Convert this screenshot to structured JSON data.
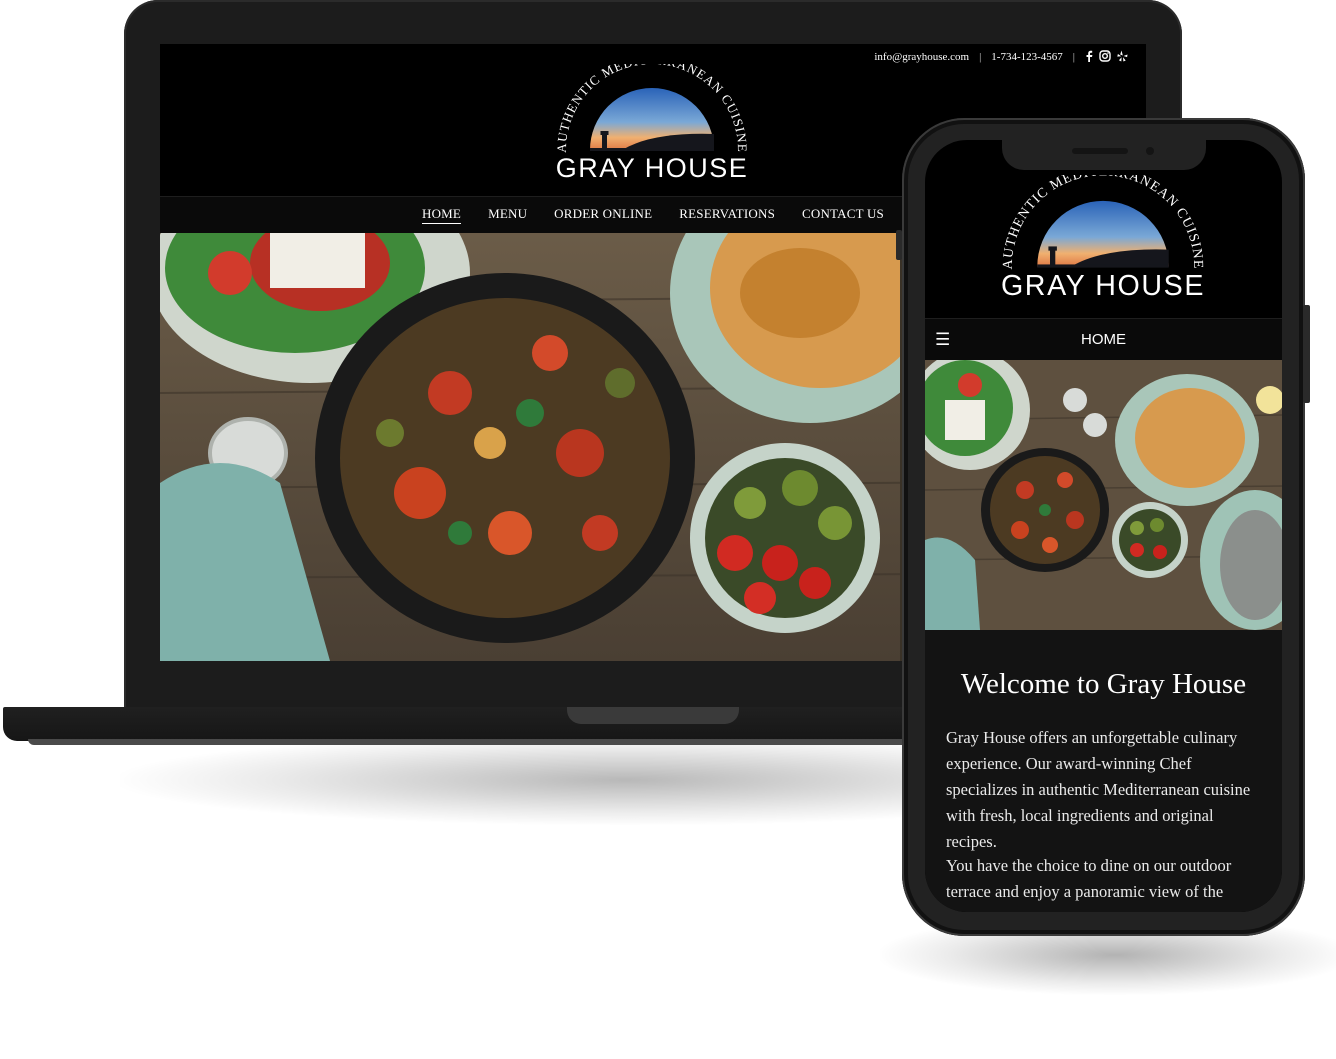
{
  "brand": {
    "name": "GRAY HOUSE",
    "tagline": "AUTHENTIC MEDITERRANEAN CUISINE"
  },
  "desktop": {
    "topbar": {
      "email": "info@grayhouse.com",
      "separator": "|",
      "phone": "1-734-123-4567",
      "social_icons": [
        "facebook-icon",
        "instagram-icon",
        "yelp-icon"
      ]
    },
    "nav": {
      "items": [
        {
          "label": "HOME",
          "active": true
        },
        {
          "label": "MENU",
          "active": false
        },
        {
          "label": "ORDER ONLINE",
          "active": false
        },
        {
          "label": "RESERVATIONS",
          "active": false
        },
        {
          "label": "CONTACT US",
          "active": false
        }
      ]
    }
  },
  "mobile": {
    "nav": {
      "menu_icon": "hamburger-menu-icon",
      "current_page": "HOME"
    },
    "welcome": {
      "heading": "Welcome to Gray House",
      "paragraph_1": "Gray House offers an unforgettable culinary experience. Our award-winning Chef specializes in authentic Mediterranean cuisine with fresh, local ingredients and original recipes.",
      "paragraph_2": "You have the choice to dine on our outdoor terrace and enjoy a panoramic view of the"
    }
  },
  "colors": {
    "background": "#000000",
    "nav_background": "#0a0a0a",
    "text": "#ffffff",
    "device_frame": "#1c1c1c",
    "sunset_top": "#3b79c9",
    "sunset_glow": "#f2a25a"
  }
}
